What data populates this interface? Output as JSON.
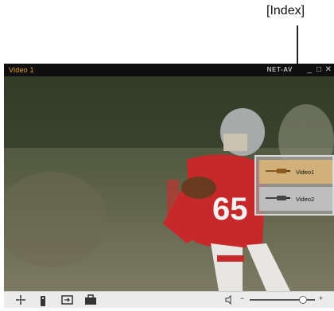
{
  "callout": {
    "label": "[Index]"
  },
  "window": {
    "title": "Video 1",
    "brand": "NET-AV",
    "controls": {
      "minimize": "_",
      "maximize": "□",
      "close": "✕"
    }
  },
  "index": {
    "items": [
      {
        "label": "Video1",
        "selected": true,
        "plug_color": "#8a5a1e"
      },
      {
        "label": "Video2",
        "selected": false,
        "plug_color": "#444444"
      }
    ]
  },
  "controlbar": {
    "icons": [
      "fit-screen-icon",
      "remote-control-icon",
      "input-switch-icon",
      "toolbox-icon"
    ],
    "volume": {
      "minus": "−",
      "plus": "+",
      "level": 0.8
    }
  },
  "colors": {
    "title": "#e7a21e",
    "selected_item": "#d2b07a"
  }
}
